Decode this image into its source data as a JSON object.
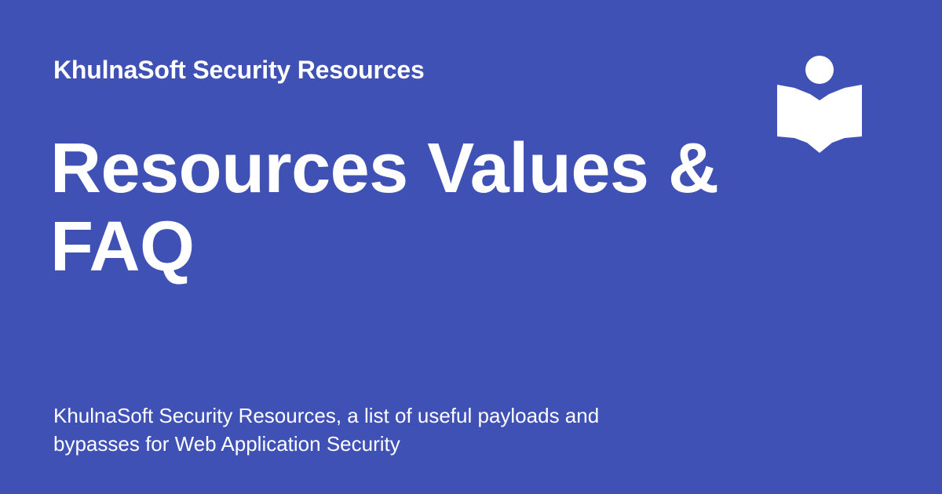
{
  "site": {
    "name": "KhulnaSoft Security Resources"
  },
  "page": {
    "title": "Resources Values & FAQ",
    "description": "KhulnaSoft Security Resources, a list of useful payloads and bypasses for Web Application Security"
  },
  "logo": {
    "icon": "book-reader-icon",
    "color": "#ffffff"
  },
  "colors": {
    "background": "#3f51b5",
    "text": "#ffffff"
  }
}
